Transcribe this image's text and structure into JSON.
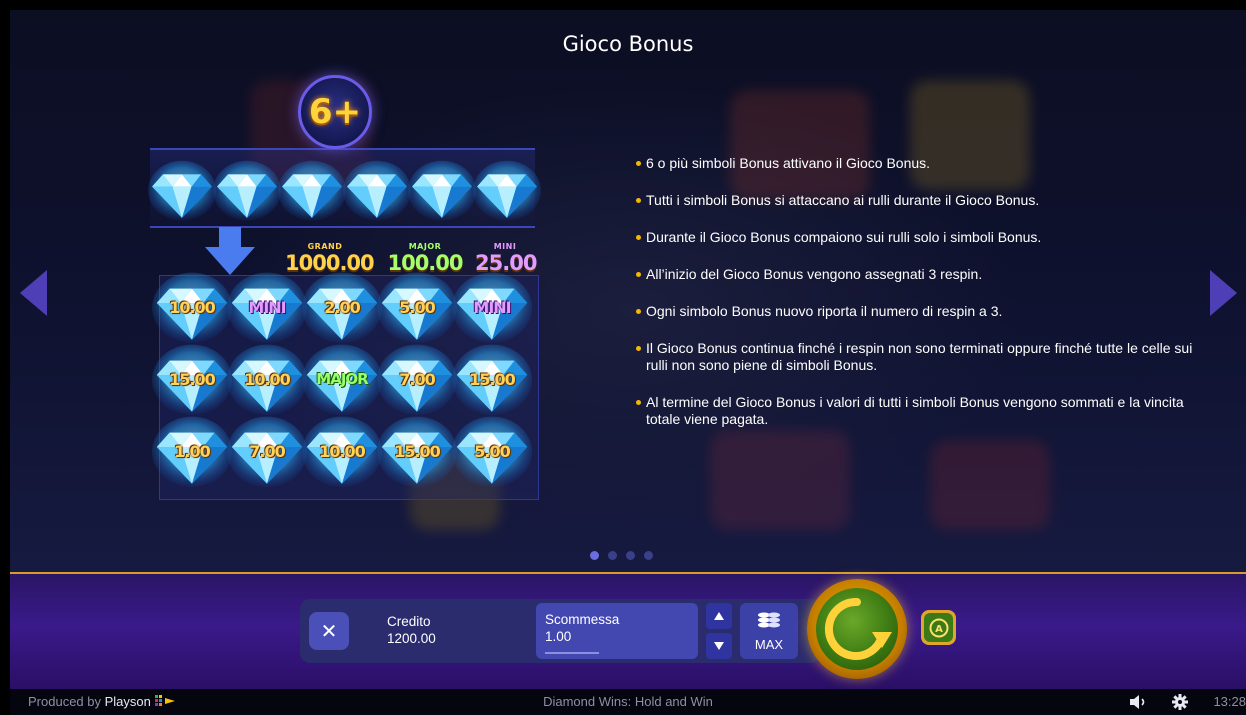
{
  "page_title": "Gioco Bonus",
  "illustration": {
    "badge": "6+",
    "jackpots": [
      {
        "label": "GRAND",
        "value": "1000.00",
        "color": "#ffd24a"
      },
      {
        "label": "MAJOR",
        "value": "100.00",
        "color": "#a6ff6a"
      },
      {
        "label": "MINI",
        "value": "25.00",
        "color": "#e49bff"
      }
    ],
    "grid": [
      [
        "10.00",
        "MINI",
        "2.00",
        "5.00",
        "MINI"
      ],
      [
        "15.00",
        "10.00",
        "MAJOR",
        "7.00",
        "15.00"
      ],
      [
        "1.00",
        "7.00",
        "10.00",
        "15.00",
        "5.00"
      ]
    ]
  },
  "rules": [
    "6 o più simboli Bonus attivano il Gioco Bonus.",
    "Tutti i simboli Bonus si attaccano ai rulli durante il Gioco Bonus.",
    "Durante il Gioco Bonus compaiono sui rulli solo i simboli Bonus.",
    "All’inizio del Gioco Bonus vengono assegnati 3 respin.",
    "Ogni simbolo Bonus nuovo riporta il numero di respin a 3.",
    "Il Gioco Bonus continua finché i respin non sono terminati oppure finché tutte le celle sui rulli non sono piene di simboli Bonus.",
    "Al termine del Gioco Bonus i valori di tutti i simboli Bonus vengono sommati e la vincita totale viene pagata."
  ],
  "pagination": {
    "total": 4,
    "active": 0
  },
  "controls": {
    "close_symbol": "✕",
    "credit_label": "Credito",
    "credit_value": "1200.00",
    "bet_label": "Scommessa",
    "bet_value": "1.00",
    "max_label": "MAX"
  },
  "footer": {
    "produced_prefix": "Produced by",
    "brand": "Playson",
    "game_name": "Diamond Wins: Hold and Win",
    "time": "13:28"
  },
  "icons": [
    "prev-arrow-icon",
    "next-arrow-icon",
    "close-icon",
    "arrow-up-icon",
    "arrow-down-icon",
    "coins-stack-icon",
    "spin-icon",
    "autoplay-icon",
    "volume-icon",
    "gear-icon",
    "playson-logo-icon",
    "diamond-icon"
  ],
  "colors": {
    "accent": "#4f3fb6",
    "bullet": "#f5b800",
    "gold": "#e8b400"
  }
}
